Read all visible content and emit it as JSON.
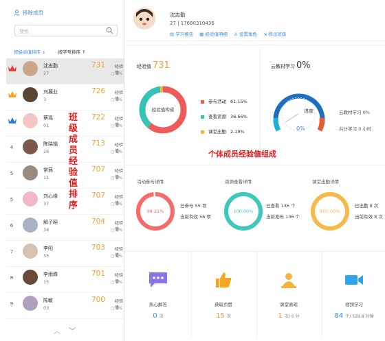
{
  "sidebar": {
    "remove_label": "移除成员",
    "search_placeholder": "搜索",
    "sort_exp": "按经验值排序",
    "sort_exp_arrow": "↓",
    "sort_id": "按学号排序",
    "sort_id_arrow": "↑",
    "points_unit": "经验值",
    "vertical_caption": "班级成员经验值排序",
    "members": [
      {
        "rank": "1",
        "name": "沈志勤",
        "number": "27",
        "points": "731",
        "sub": "0%",
        "crown": "red",
        "avatar_color": "#c9a48a"
      },
      {
        "rank": "2",
        "name": "刘展业",
        "number": "3",
        "points": "726",
        "sub": "0%",
        "crown": "orange",
        "avatar_color": "#5a4632"
      },
      {
        "rank": "3",
        "name": "蔡瑶",
        "number": "01",
        "points": "722",
        "sub": "0%",
        "crown": "blue",
        "avatar_color": "#f2c6c6"
      },
      {
        "rank": "4",
        "name": "陈晓娟",
        "number": "26",
        "points": "713",
        "sub": "0%",
        "crown": "",
        "avatar_color": "#7a5a4a"
      },
      {
        "rank": "5",
        "name": "常茜",
        "number": "11",
        "points": "707",
        "sub": "0%",
        "crown": "",
        "avatar_color": "#9a8a82"
      },
      {
        "rank": "5",
        "name": "刘心缘",
        "number": "37",
        "points": "707",
        "sub": "0%",
        "crown": "",
        "avatar_color": "#f3b8c8"
      },
      {
        "rank": "6",
        "name": "解子昭",
        "number": "34",
        "points": "704",
        "sub": "0%",
        "crown": "",
        "avatar_color": "#a7b2c4"
      },
      {
        "rank": "7",
        "name": "李阳",
        "number": "35",
        "points": "703",
        "sub": "0%",
        "crown": "",
        "avatar_color": "#d7c2b2"
      },
      {
        "rank": "8",
        "name": "李雨霖",
        "number": "15",
        "points": "701",
        "sub": "0%",
        "crown": "",
        "avatar_color": "#6a4a3a"
      },
      {
        "rank": "9",
        "name": "陈敏",
        "number": "03",
        "points": "700",
        "sub": "0%",
        "crown": "",
        "avatar_color": "#b0a0c0"
      }
    ],
    "pager_up": "︿",
    "pager_down": "﹀"
  },
  "profile": {
    "name": "沈志勤",
    "info": "27 | 17680310436",
    "links": [
      "学习报告",
      "经验值明细",
      "设置角色",
      "移出班级"
    ]
  },
  "experience": {
    "label": "经验值",
    "value": "731",
    "donut_label": "经验值构成",
    "legend": [
      {
        "name": "参与活动",
        "pct": "61.15%",
        "color": "#ef5b5b"
      },
      {
        "name": "查看资源",
        "pct": "36.66%",
        "color": "#36c2b4"
      },
      {
        "name": "课堂出勤",
        "pct": "2.19%",
        "color": "#f5b342"
      }
    ],
    "segments": [
      61.15,
      36.66,
      2.19
    ]
  },
  "cloud": {
    "label": "云教材学习",
    "value": "0%",
    "gauge_label": "进度",
    "gauge_value": "0%",
    "progress": 0,
    "stat1": "云教材学习 0%",
    "stat2": "共计学习 0 小时"
  },
  "caption": "个体成员经验值组成",
  "activity": {
    "title": "活动参与详情",
    "pct": "98.21%",
    "line1": "已参与 55 项",
    "line2": "当前有效 56 项",
    "progress": 98.21,
    "color": "#f76a6a"
  },
  "resource": {
    "title": "资源查看详情",
    "pct": "100.00%",
    "line1": "已查看 136 个",
    "line2": "当前发布 136 个",
    "progress": 100,
    "color": "#3cc8bb"
  },
  "attendance": {
    "title": "课堂出勤详情",
    "pct": "100.00%",
    "line1": "已出勤 8 次",
    "line2": "当前有效 8 次",
    "progress": 100,
    "color": "#f7b94a"
  },
  "stats": [
    {
      "label": "热心解答",
      "value": "0",
      "unit": "次",
      "icon": "chat-bubble-icon",
      "color": "#8a74ea",
      "orange": false
    },
    {
      "label": "获取点赞",
      "value": "15",
      "unit": "次",
      "icon": "thumbs-up-icon",
      "color": "#f5a623",
      "orange": true
    },
    {
      "label": "课堂表现",
      "value": "1",
      "unit": "次/ 0 分",
      "icon": "person-card-icon",
      "color": "#f5b342",
      "orange": true
    },
    {
      "label": "视频学习",
      "value": "84",
      "unit": "个/ 529.8 分钟",
      "icon": "video-camera-icon",
      "color": "#2fa5f0",
      "orange": false
    }
  ]
}
